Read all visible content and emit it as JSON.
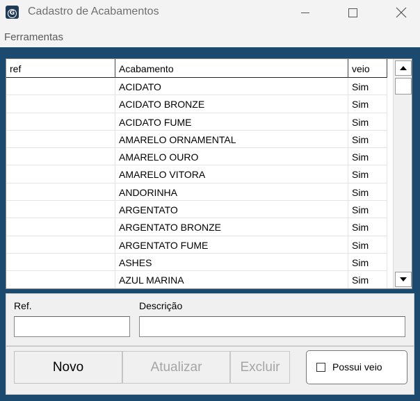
{
  "window": {
    "title": "Cadastro de Acabamentos",
    "app_icon": "G"
  },
  "menu": {
    "items": [
      "Ferramentas"
    ]
  },
  "grid": {
    "columns": [
      "ref",
      "Acabamento",
      "veio"
    ],
    "rows": [
      {
        "ref": "",
        "acabamento": "ACIDATO",
        "veio": "Sim"
      },
      {
        "ref": "",
        "acabamento": "ACIDATO BRONZE",
        "veio": "Sim"
      },
      {
        "ref": "",
        "acabamento": "ACIDATO FUME",
        "veio": "Sim"
      },
      {
        "ref": "",
        "acabamento": "AMARELO ORNAMENTAL",
        "veio": "Sim"
      },
      {
        "ref": "",
        "acabamento": "AMARELO OURO",
        "veio": "Sim"
      },
      {
        "ref": "",
        "acabamento": "AMARELO VITORA",
        "veio": "Sim"
      },
      {
        "ref": "",
        "acabamento": "ANDORINHA",
        "veio": "Sim"
      },
      {
        "ref": "",
        "acabamento": "ARGENTATO",
        "veio": "Sim"
      },
      {
        "ref": "",
        "acabamento": "ARGENTATO BRONZE",
        "veio": "Sim"
      },
      {
        "ref": "",
        "acabamento": "ARGENTATO FUME",
        "veio": "Sim"
      },
      {
        "ref": "",
        "acabamento": "ASHES",
        "veio": "Sim"
      },
      {
        "ref": "",
        "acabamento": "AZUL MARINA",
        "veio": "Sim"
      }
    ]
  },
  "form": {
    "ref_label": "Ref.",
    "ref_value": "",
    "desc_label": "Descrição",
    "desc_value": ""
  },
  "buttons": {
    "novo": "Novo",
    "atualizar": "Atualizar",
    "excluir": "Excluir",
    "possui_veio": "Possui veio",
    "possui_veio_checked": false
  },
  "colors": {
    "window_bg": "#1b4a6e",
    "panel_bg": "#f0f0f0",
    "disabled_text": "#a5a5a5"
  }
}
